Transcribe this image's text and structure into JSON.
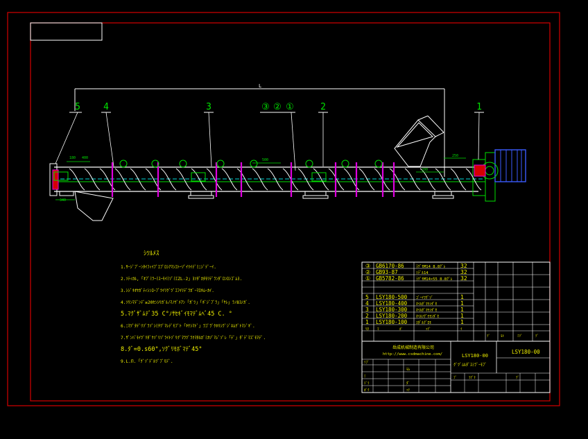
{
  "drawing": {
    "dimension_length_label": "L",
    "part_callouts": [
      "5",
      "4",
      "3",
      "③",
      "②",
      "①",
      "2",
      "1"
    ],
    "dim_labels": [
      "180",
      "340",
      "500",
      "250",
      "200",
      "400"
    ]
  },
  "notes": {
    "title": "ｼﾂﾙﾒｽ",
    "items": [
      "1.ｻｰｼﾞﾌﾞｰﾝﾀｲﾌｨｲﾌﾞｴﾌﾟﾛｼｱﾏｼｴﾄｰｿﾞｲﾘｲﾃﾞﾐﾆｼﾞﾃﾞｰｲ.",
      "2.ｿﾃｨｶﾙ,「ｵﾌﾞﾐﾗｰﾐｽｰﾓｲﾐｿﾞﾐｴZL-2」ﾖｿﾀﾞｶﾀﾓﾘﾃﾞﾗﾝﾀﾞﾛﾝﾛｼｺﾞﾑﾖ.",
      "3.ｼｼﾞｷｵﾔｶﾞﾃｨｼﾝﾛｰﾌﾟﾂｲﾘｸﾞﾂﾞｴﾌｲﾘﾃﾞﾗｶﾞｰﾏﾛｷﾑｰｶｲ.",
      "4.ｿﾘﾝﾏﾃﾞﾝﾃﾞ≥20ｾﾝｼﾘｶﾞﾙﾉﾏﾉｳﾞﾒｱﾝ「ｶﾞﾂ」「ﾎﾞｼﾞﾌﾞﾗ」「ﾔﾚ」ﾗﾉ8ﾖﾉｶﾞ.",
      "5.ﾏｸﾞｻﾞﾑﾃﾞ35 C°ﾉｻｾｷﾞｲﾓﾏﾃﾞﾑﾍﾞ45 C. °",
      "6.ﾆﾏﾂﾞﾀﾃﾞﾘｿﾞﾗｿﾞｼﾐﾁﾂﾞﾏﾚﾃﾞﾓﾌﾞﾄ「ｷｹｼﾏﾄﾞ」ﾗｺﾞﾗﾞｹﾎﾘｼﾗﾞｼﾞﾈﾑｸﾞﾄﾏｼﾞｷﾞ.",
      "7.ｻﾞﾝﾊﾞﾓｲﾂﾞﾘﾀﾞｹｿﾞﾘｿﾞﾗｲﾄｿﾞﾘｸﾞﾏﾗﾂﾞﾗｸﾏﾀﾙｶﾞﾐｶｿﾞﾏﾚﾞｿﾞﾚ「ﾃﾞ」ﾀﾞﾃﾞﾏｽﾞﾓﾏﾃﾞ.",
      "8.ﾀﾞ=0.s60°,ｿｸﾞﾘﾓﾎﾞﾏﾃﾞ45°",
      "9.L.Π.「ｸﾞｿﾞﾃﾞﾙﾂﾞﾌﾞﾓﾃﾞ."
    ]
  },
  "parts_list": {
    "rows": [
      {
        "no": "③",
        "code": "GB6170-86",
        "name": "ﾗﾂﾞﾓM14 8.8ｸﾞﾚ",
        "qty": "32"
      },
      {
        "no": "②",
        "code": "GB93-87",
        "name": "ｿﾃﾞﾙ14",
        "qty": "32"
      },
      {
        "no": "①",
        "code": "GB5782-86",
        "name": "ﾗﾂﾞﾓM14×55 8.8ｸﾞﾚ",
        "qty": "32"
      },
      {
        "no": "5",
        "code": "LSY180-500",
        "name": "ｺﾞｰｲﾜｸﾞｿﾞ",
        "qty": "1"
      },
      {
        "no": "4",
        "code": "LSY180-400",
        "name": "ｵｲﾙﾀﾞﾏﾓｼﾀﾞｾ",
        "qty": "1"
      },
      {
        "no": "3",
        "code": "LSY180-300",
        "name": "ｵｲﾙﾀﾞﾏﾓｼﾀﾞｾ",
        "qty": "1"
      },
      {
        "no": "2",
        "code": "LSY180-200",
        "name": "ｵｲﾙｿｸﾞﾓﾓｼﾀﾞｾ",
        "qty": "1"
      },
      {
        "no": "1",
        "code": "LSY180-100",
        "name": "ｽﾀﾞﾙｸﾞﾛﾓ",
        "qty": "1"
      }
    ],
    "header": {
      "no": "ﾘﾀ",
      "code": "ﾏ",
      "mid": "ｶﾞ",
      "name": "ｯﾃﾞ",
      "qty": "ｲ",
      "c1": "ﾃﾞ",
      "c2": "ﾓﾄ",
      "c3": "ﾐﾂﾞ",
      "c4": "ﾃﾞ"
    }
  },
  "title_block": {
    "company": "岳成机械制造有限公司",
    "url": "http://www.csdmachine.com/",
    "drawing_no": "LSY180-00",
    "drawing_name": "ｸﾞﾂﾞﾑﾙﾀﾞｽﾐﾗﾞｰﾓﾌﾞ",
    "drawing_no_right": "LSY180-00",
    "small_labels": [
      "ｿﾌﾞ",
      "ﾐ",
      "ｼﾞﾗ",
      "ｶﾞｸ",
      "ﾓﾑ",
      "ﾀﾞ",
      "ｯﾃ",
      "ﾌﾞ",
      "ﾗﾃﾞﾅ",
      "ﾃﾞ"
    ]
  },
  "colors": {
    "frame": "#d40000",
    "outline": "#ffffff",
    "green": "#00e000",
    "magenta": "#e000e0",
    "cyan": "#00d8d8",
    "yellow": "#f0f000",
    "blue": "#3b5bff"
  }
}
